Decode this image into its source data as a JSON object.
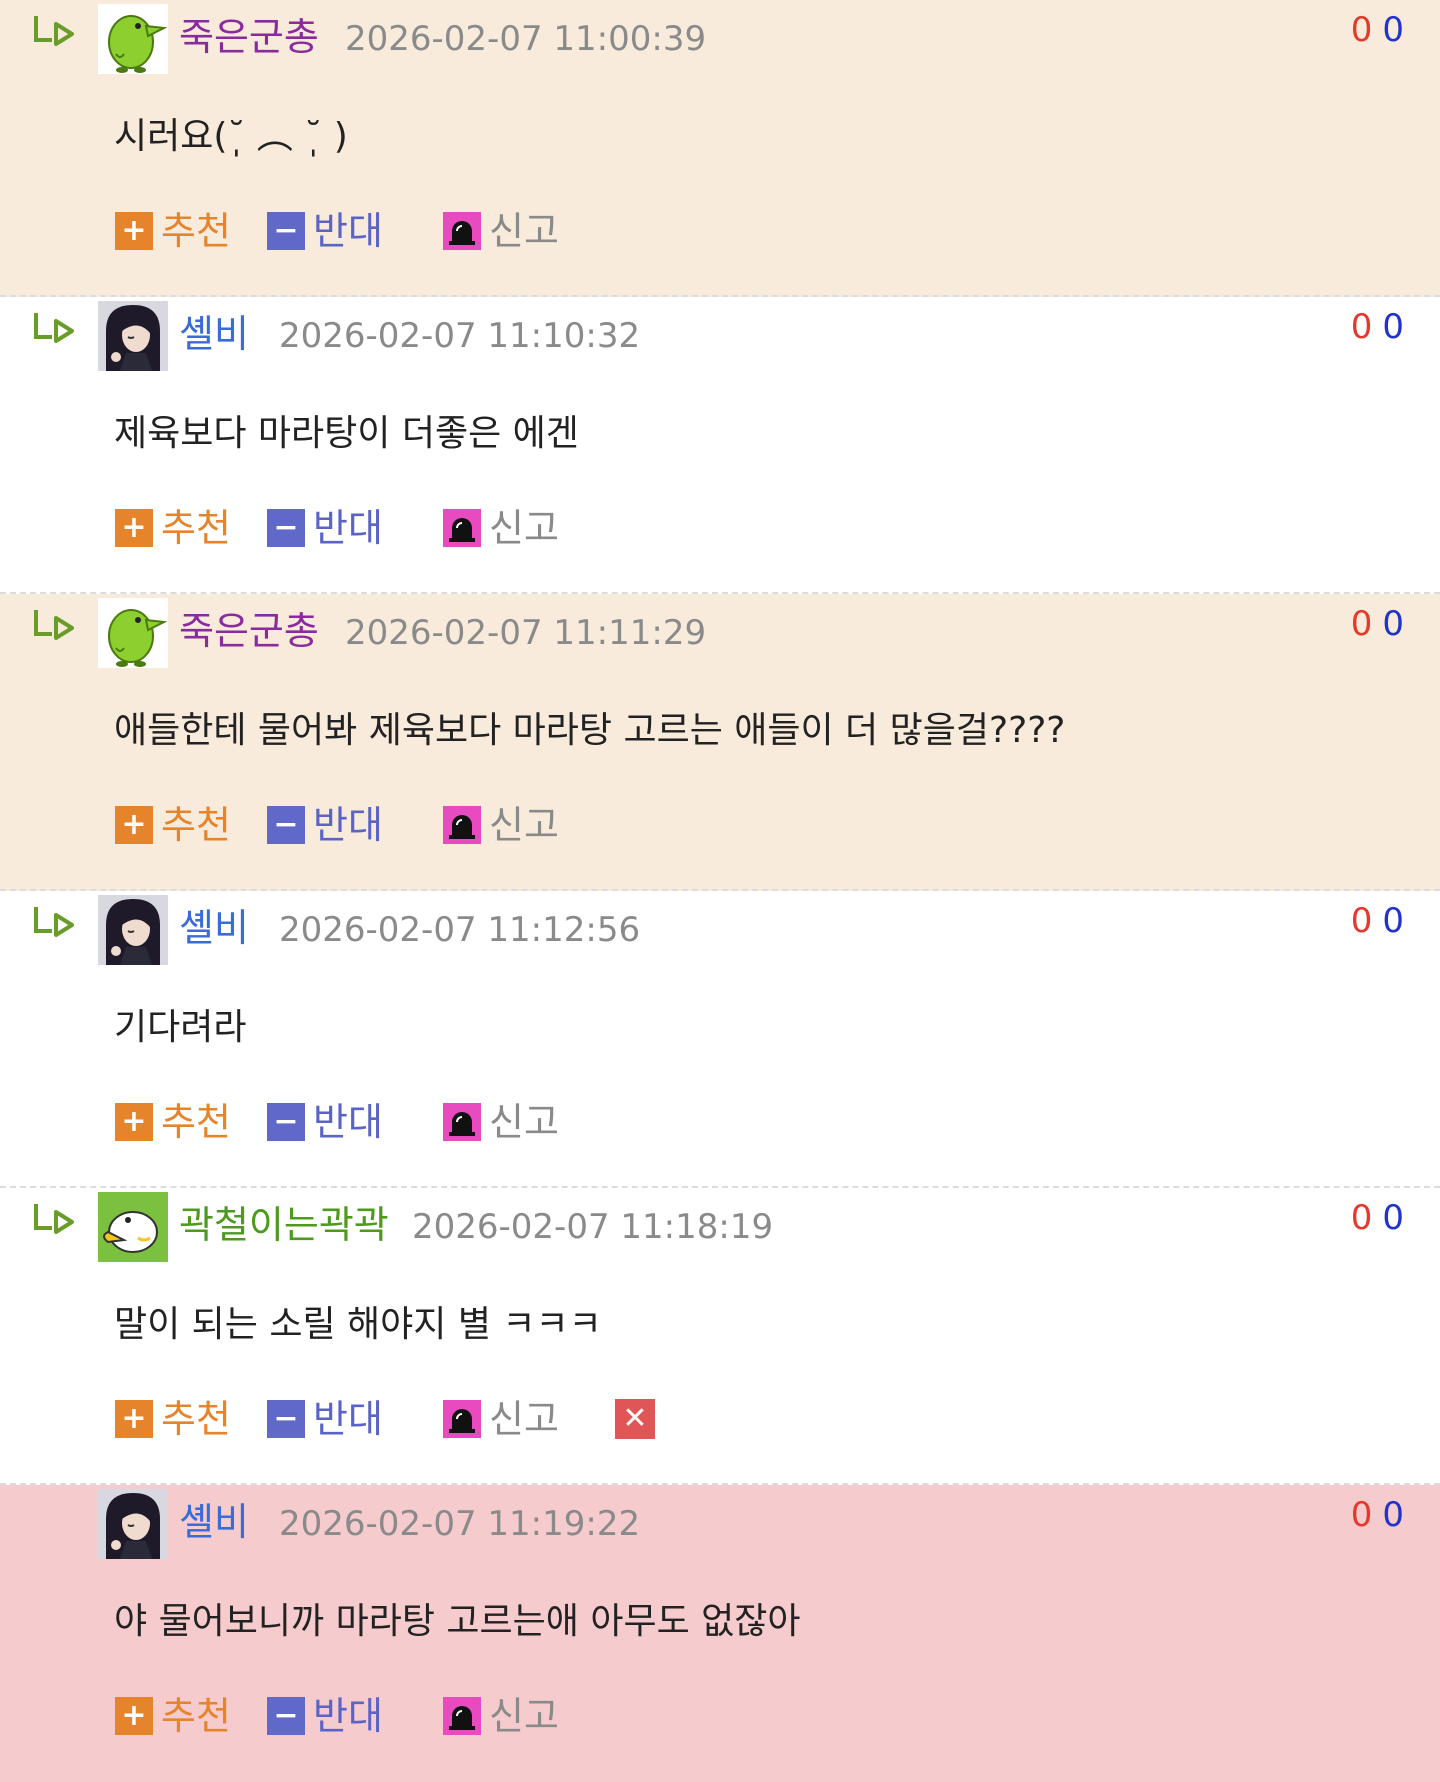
{
  "actions": {
    "upvote_label": "추천",
    "downvote_label": "반대",
    "report_label": "신고"
  },
  "colors": {
    "nick_purple": "#8b2a9e",
    "nick_blue": "#3b6bd6",
    "nick_green": "#4d9a1e",
    "bg_beige": "#f8ebdb",
    "bg_pink": "#f5cbcd",
    "up": "#e6842c",
    "down": "#5b64c4"
  },
  "comments": [
    {
      "nickname": "죽은군총",
      "timestamp": "2026-02-07 11:00:39",
      "up": "0",
      "down": "0",
      "text": "시러요(˘̩̩̩ ︵ ˘̩̩̩ )",
      "avatar_icon": "green-bird-icon"
    },
    {
      "nickname": "셸비",
      "timestamp": "2026-02-07 11:10:32",
      "up": "0",
      "down": "0",
      "text": "제육보다 마라탕이 더좋은 에겐",
      "avatar_icon": "dark-hair-girl-icon"
    },
    {
      "nickname": "죽은군총",
      "timestamp": "2026-02-07 11:11:29",
      "up": "0",
      "down": "0",
      "text": "애들한테 물어봐 제육보다 마라탕 고르는 애들이 더 많을걸????",
      "avatar_icon": "green-bird-icon"
    },
    {
      "nickname": "셸비",
      "timestamp": "2026-02-07 11:12:56",
      "up": "0",
      "down": "0",
      "text": "기다려라",
      "avatar_icon": "dark-hair-girl-icon"
    },
    {
      "nickname": "곽철이는곽곽",
      "timestamp": "2026-02-07 11:18:19",
      "up": "0",
      "down": "0",
      "text": "말이 되는 소릴 해야지 별 ㅋㅋㅋ",
      "avatar_icon": "white-duck-icon"
    },
    {
      "nickname": "셸비",
      "timestamp": "2026-02-07 11:19:22",
      "up": "0",
      "down": "0",
      "text": "야 물어보니까 마라탕 고르는애 아무도 없잖아",
      "avatar_icon": "dark-hair-girl-icon"
    }
  ]
}
